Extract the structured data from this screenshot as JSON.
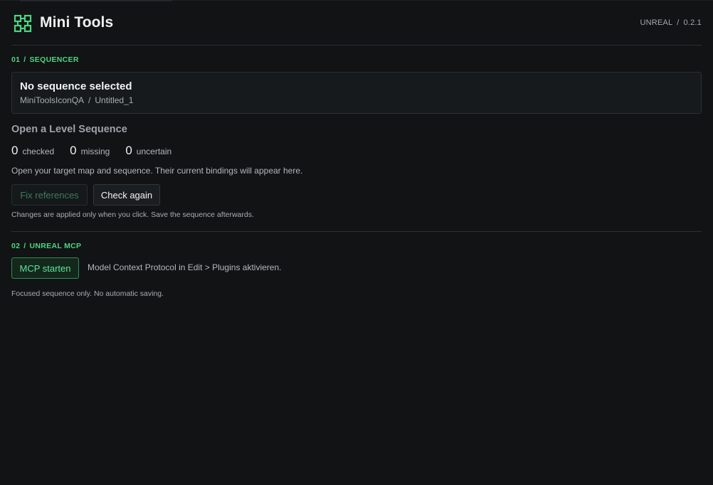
{
  "app": {
    "title": "Mini Tools",
    "engine": "UNREAL",
    "version_separator": "/",
    "version": "0.2.1",
    "accent_color": "#4fd482",
    "icon": "node-graph-icon"
  },
  "sections": {
    "sequencer": {
      "number": "01",
      "separator": "/",
      "label": "SEQUENCER"
    },
    "mcp": {
      "number": "02",
      "separator": "/",
      "label": "UNREAL MCP"
    }
  },
  "sequence": {
    "title": "No sequence selected",
    "project": "MiniToolsIconQA",
    "path_separator": "/",
    "asset": "Untitled_1"
  },
  "level": {
    "heading": "Open a Level Sequence",
    "stats": [
      {
        "value": "0",
        "label": "checked"
      },
      {
        "value": "0",
        "label": "missing"
      },
      {
        "value": "0",
        "label": "uncertain"
      }
    ],
    "help": "Open your target map and sequence. Their current bindings will appear here."
  },
  "actions": {
    "fix_label": "Fix references",
    "fix_disabled": true,
    "check_label": "Check again",
    "note": "Changes are applied only when you click. Save the sequence afterwards."
  },
  "mcp": {
    "button_label": "MCP starten",
    "hint": "Model Context Protocol in Edit > Plugins aktivieren.",
    "footer": "Focused sequence only. No automatic saving."
  }
}
